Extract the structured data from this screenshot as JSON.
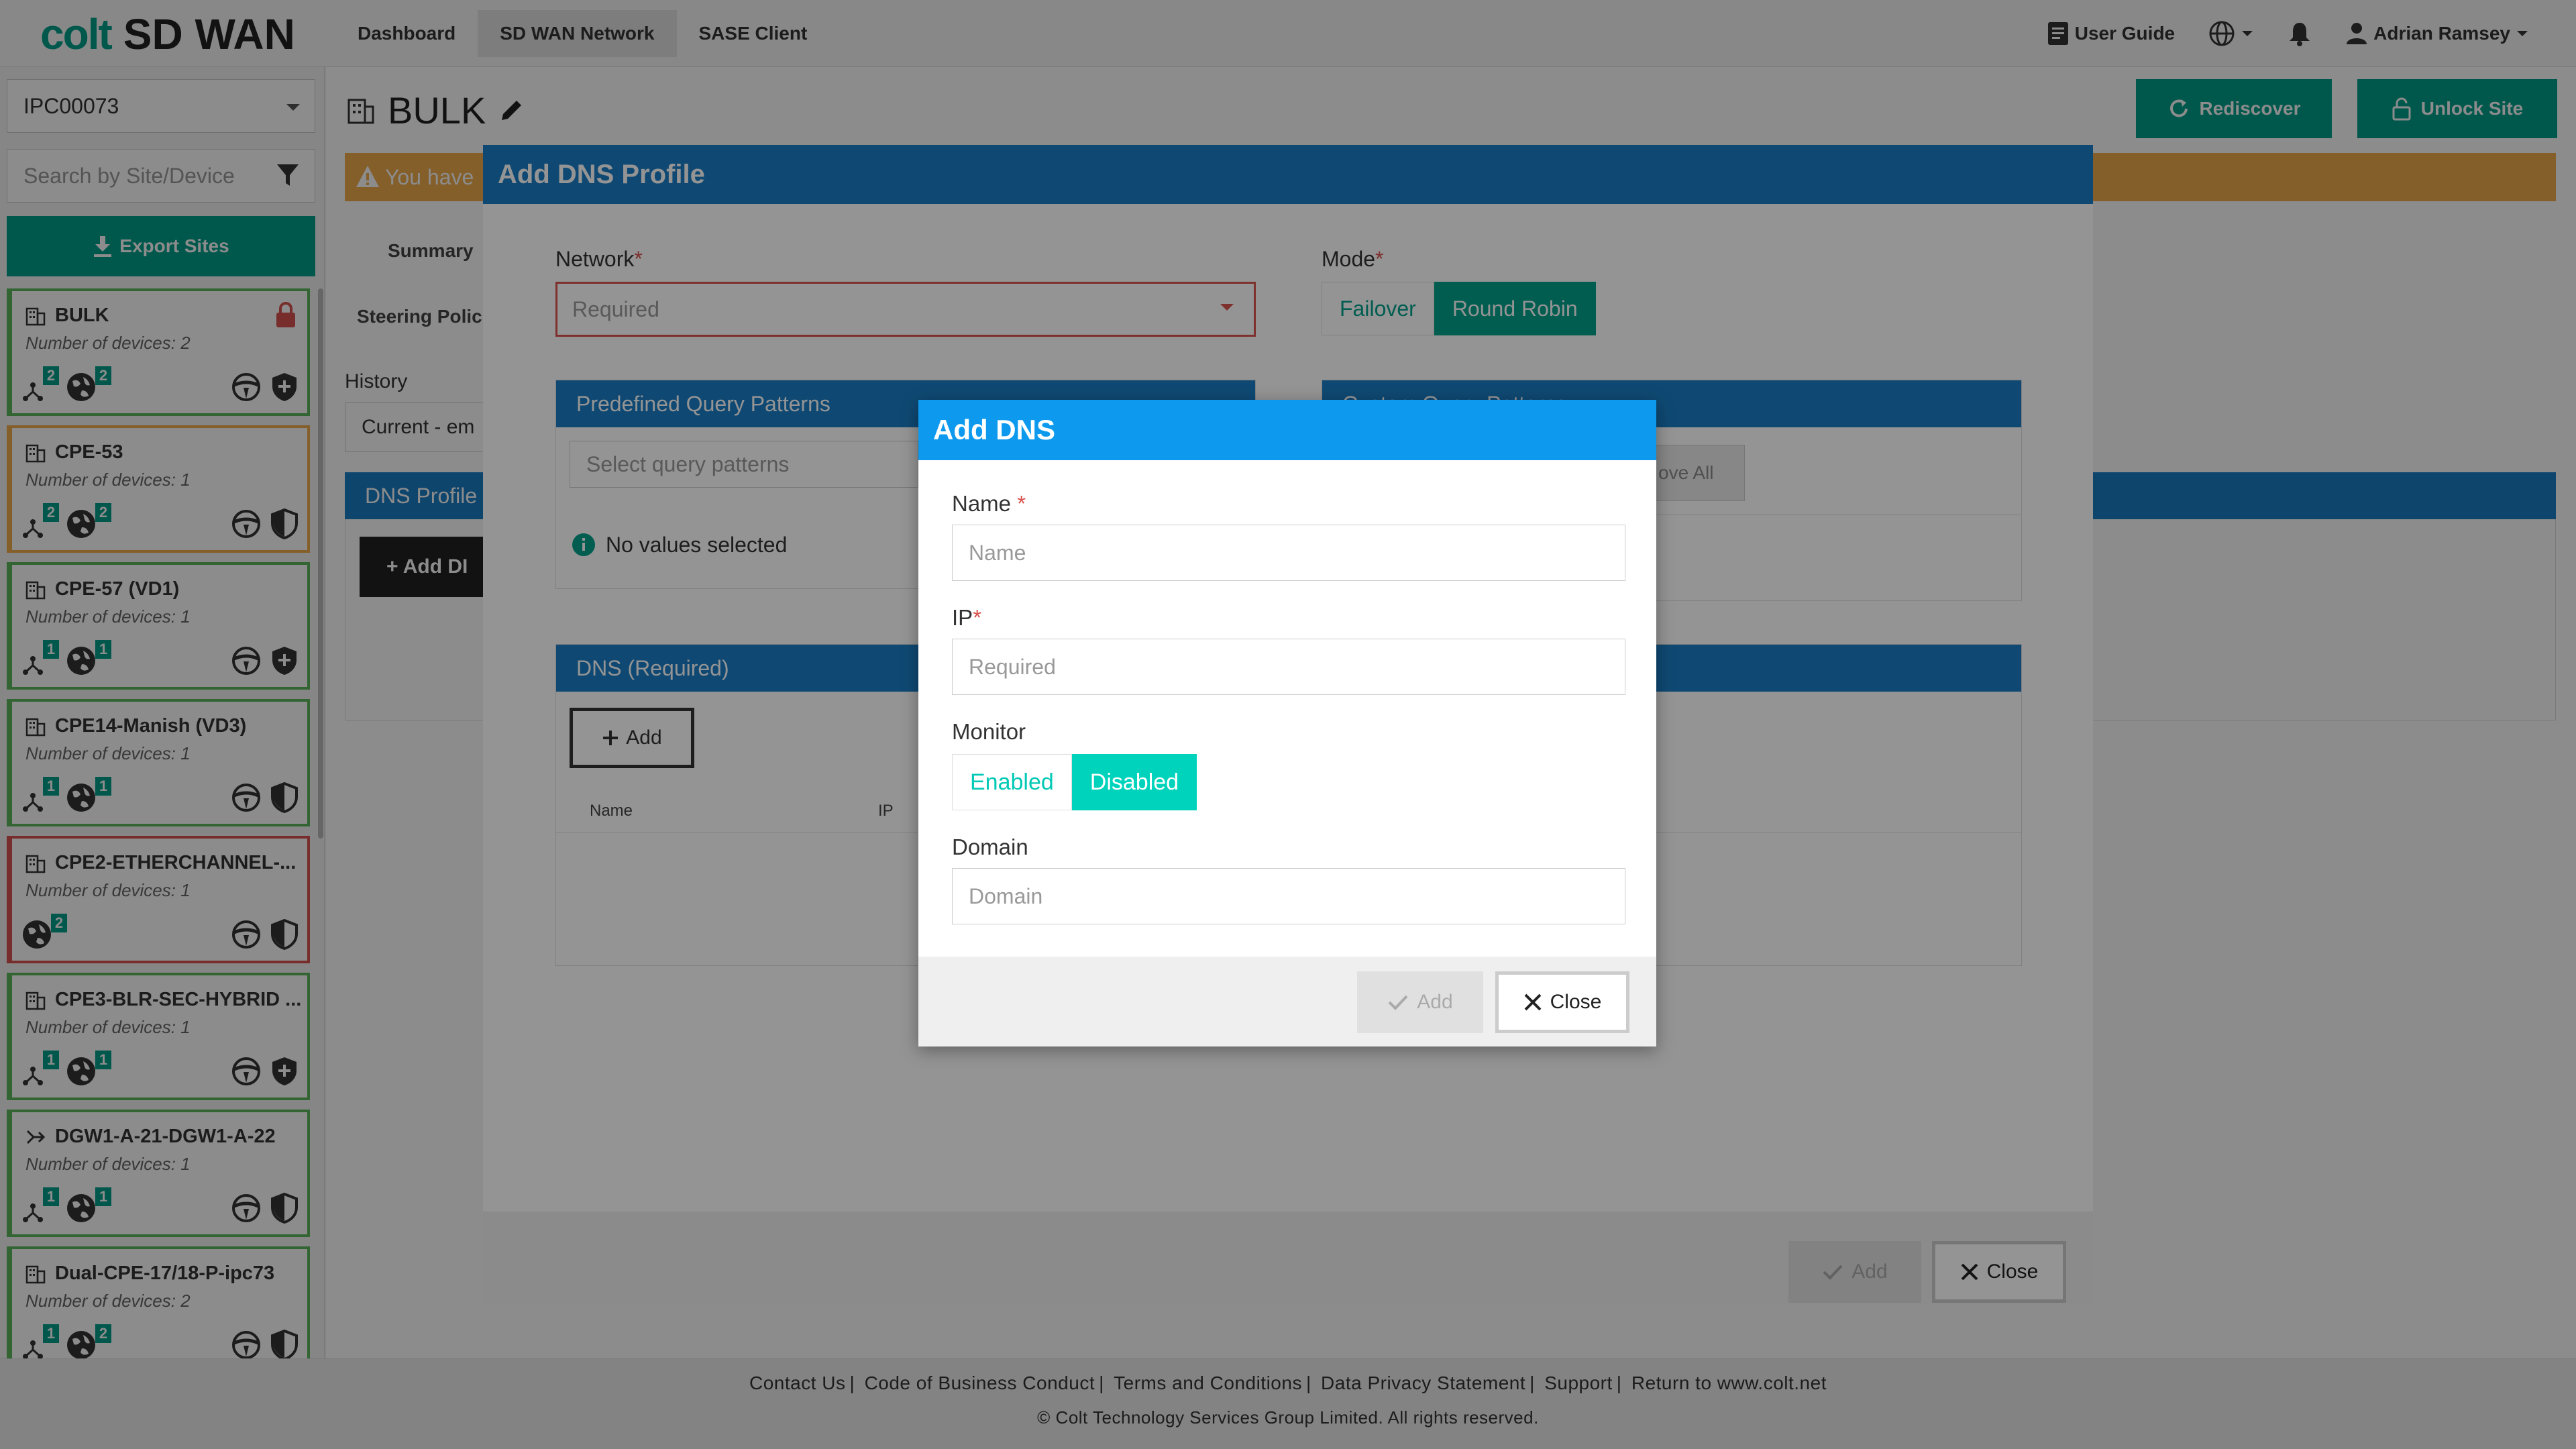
{
  "header": {
    "logo_brand": "colt",
    "logo_product": "SD WAN",
    "nav": [
      "Dashboard",
      "SD WAN Network",
      "SASE Client"
    ],
    "user_guide": "User Guide",
    "user_name": "Adrian Ramsey"
  },
  "sidebar": {
    "site_select": "IPC00073",
    "search_placeholder": "Search by Site/Device",
    "export_label": "Export Sites",
    "sites": [
      {
        "name": "BULK",
        "devices": "Number of devices: 2",
        "b1": "2",
        "b2": "2",
        "status": "green"
      },
      {
        "name": "CPE-53",
        "devices": "Number of devices: 1",
        "b1": "2",
        "b2": "2",
        "status": "orange"
      },
      {
        "name": "CPE-57 (VD1)",
        "devices": "Number of devices: 1",
        "b1": "1",
        "b2": "1",
        "status": "green"
      },
      {
        "name": "CPE14-Manish (VD3)",
        "devices": "Number of devices: 1",
        "b1": "1",
        "b2": "1",
        "status": "green"
      },
      {
        "name": "CPE2-ETHERCHANNEL-...",
        "devices": "Number of devices: 1",
        "b1": "",
        "b2": "2",
        "status": "red"
      },
      {
        "name": "CPE3-BLR-SEC-HYBRID ...",
        "devices": "Number of devices: 1",
        "b1": "1",
        "b2": "1",
        "status": "green"
      },
      {
        "name": "DGW1-A-21-DGW1-A-22",
        "devices": "Number of devices: 1",
        "b1": "1",
        "b2": "1",
        "status": "green"
      },
      {
        "name": "Dual-CPE-17/18-P-ipc73",
        "devices": "Number of devices: 2",
        "b1": "1",
        "b2": "2",
        "status": "green"
      }
    ]
  },
  "main": {
    "title": "BULK",
    "rediscover": "Rediscover",
    "unlock": "Unlock Site",
    "warning": "You have",
    "tab_summary": "Summary",
    "tab_steering": "Steering Polic",
    "history_label": "History",
    "history_value": "Current - em",
    "dns_profiles": "DNS Profile",
    "add_dns_profile": "+ Add DI"
  },
  "profile_modal": {
    "title": "Add DNS Profile",
    "network_label": "Network",
    "network_placeholder": "Required",
    "mode_label": "Mode",
    "mode_options": [
      "Failover",
      "Round Robin"
    ],
    "predefined_title": "Predefined Query Patterns",
    "predefined_placeholder": "Select query patterns",
    "no_values": "No values selected",
    "custom_title": "Custom Query Patterns",
    "remove_all": "ove All",
    "dns_title": "DNS (Required)",
    "add_label": "Add",
    "col_name": "Name",
    "col_ip": "IP",
    "footer_add": "Add",
    "footer_close": "Close"
  },
  "dns_modal": {
    "title": "Add DNS",
    "name_label": "Name",
    "name_placeholder": "Name",
    "ip_label": "IP",
    "ip_placeholder": "Required",
    "monitor_label": "Monitor",
    "monitor_options": [
      "Enabled",
      "Disabled"
    ],
    "domain_label": "Domain",
    "domain_placeholder": "Domain",
    "add": "Add",
    "close": "Close"
  },
  "footer": {
    "links": [
      "Contact Us",
      "Code of Business Conduct",
      "Terms and Conditions",
      "Data Privacy Statement",
      "Support",
      "Return to www.colt.net"
    ],
    "copyright": "© Colt Technology Services Group Limited. All rights reserved."
  },
  "colors": {
    "brand_teal": "#00a08a",
    "modal_blue": "#1a7ec6",
    "dns_blue": "#0d9aee",
    "warning": "#f0ad4e",
    "error": "#d9534f"
  }
}
